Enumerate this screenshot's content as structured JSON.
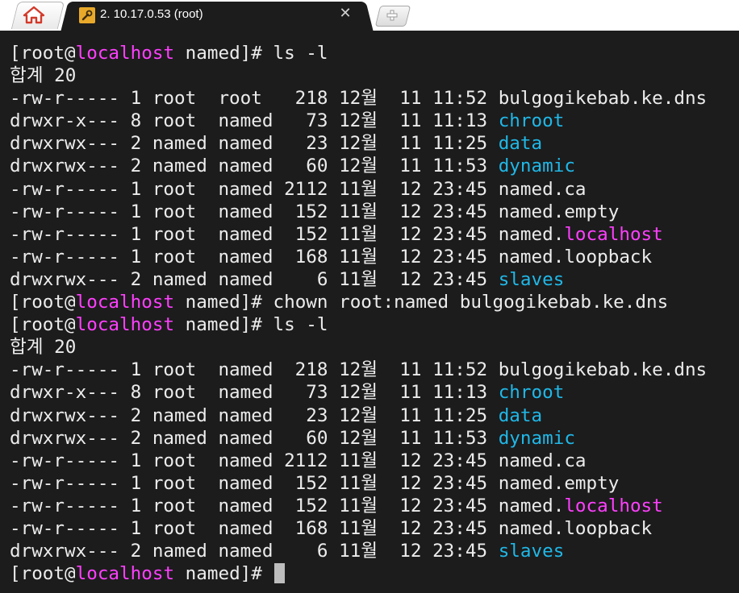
{
  "tabs": {
    "home_icon": "home-icon",
    "session_icon": "wrench-icon",
    "session_title": "2. 10.17.0.53 (root)",
    "close_icon": "close-icon",
    "close_glyph": "✕",
    "new_tab_icon": "plus-icon"
  },
  "colors": {
    "background": "#1c1c1c",
    "text": "#ececec",
    "hostname": "#ff3fff",
    "directory": "#20b8e8",
    "cursor": "#bdbdbd"
  },
  "terminal": {
    "lines": [
      {
        "segments": [
          {
            "text": "[root@",
            "color": "default"
          },
          {
            "text": "localhost",
            "color": "magenta"
          },
          {
            "text": " named]# ls -l",
            "color": "default"
          }
        ]
      },
      {
        "segments": [
          {
            "text": "합계 20",
            "color": "default"
          }
        ]
      },
      {
        "segments": [
          {
            "text": "-rw-r----- 1 root  root   218 12월  11 11:52 bulgogikebab.ke.dns",
            "color": "default"
          }
        ]
      },
      {
        "segments": [
          {
            "text": "drwxr-x--- 8 root  named   73 12월  11 11:13 ",
            "color": "default"
          },
          {
            "text": "chroot",
            "color": "cyan"
          }
        ]
      },
      {
        "segments": [
          {
            "text": "drwxrwx--- 2 named named   23 12월  11 11:25 ",
            "color": "default"
          },
          {
            "text": "data",
            "color": "cyan"
          }
        ]
      },
      {
        "segments": [
          {
            "text": "drwxrwx--- 2 named named   60 12월  11 11:53 ",
            "color": "default"
          },
          {
            "text": "dynamic",
            "color": "cyan"
          }
        ]
      },
      {
        "segments": [
          {
            "text": "-rw-r----- 1 root  named 2112 11월  12 23:45 named.ca",
            "color": "default"
          }
        ]
      },
      {
        "segments": [
          {
            "text": "-rw-r----- 1 root  named  152 11월  12 23:45 named.empty",
            "color": "default"
          }
        ]
      },
      {
        "segments": [
          {
            "text": "-rw-r----- 1 root  named  152 11월  12 23:45 named.",
            "color": "default"
          },
          {
            "text": "localhost",
            "color": "magenta"
          }
        ]
      },
      {
        "segments": [
          {
            "text": "-rw-r----- 1 root  named  168 11월  12 23:45 named.loopback",
            "color": "default"
          }
        ]
      },
      {
        "segments": [
          {
            "text": "drwxrwx--- 2 named named    6 11월  12 23:45 ",
            "color": "default"
          },
          {
            "text": "slaves",
            "color": "cyan"
          }
        ]
      },
      {
        "segments": [
          {
            "text": "[root@",
            "color": "default"
          },
          {
            "text": "localhost",
            "color": "magenta"
          },
          {
            "text": " named]# chown root:named bulgogikebab.ke.dns",
            "color": "default"
          }
        ]
      },
      {
        "segments": [
          {
            "text": "[root@",
            "color": "default"
          },
          {
            "text": "localhost",
            "color": "magenta"
          },
          {
            "text": " named]# ls -l",
            "color": "default"
          }
        ]
      },
      {
        "segments": [
          {
            "text": "합계 20",
            "color": "default"
          }
        ]
      },
      {
        "segments": [
          {
            "text": "-rw-r----- 1 root  named  218 12월  11 11:52 bulgogikebab.ke.dns",
            "color": "default"
          }
        ]
      },
      {
        "segments": [
          {
            "text": "drwxr-x--- 8 root  named   73 12월  11 11:13 ",
            "color": "default"
          },
          {
            "text": "chroot",
            "color": "cyan"
          }
        ]
      },
      {
        "segments": [
          {
            "text": "drwxrwx--- 2 named named   23 12월  11 11:25 ",
            "color": "default"
          },
          {
            "text": "data",
            "color": "cyan"
          }
        ]
      },
      {
        "segments": [
          {
            "text": "drwxrwx--- 2 named named   60 12월  11 11:53 ",
            "color": "default"
          },
          {
            "text": "dynamic",
            "color": "cyan"
          }
        ]
      },
      {
        "segments": [
          {
            "text": "-rw-r----- 1 root  named 2112 11월  12 23:45 named.ca",
            "color": "default"
          }
        ]
      },
      {
        "segments": [
          {
            "text": "-rw-r----- 1 root  named  152 11월  12 23:45 named.empty",
            "color": "default"
          }
        ]
      },
      {
        "segments": [
          {
            "text": "-rw-r----- 1 root  named  152 11월  12 23:45 named.",
            "color": "default"
          },
          {
            "text": "localhost",
            "color": "magenta"
          }
        ]
      },
      {
        "segments": [
          {
            "text": "-rw-r----- 1 root  named  168 11월  12 23:45 named.loopback",
            "color": "default"
          }
        ]
      },
      {
        "segments": [
          {
            "text": "drwxrwx--- 2 named named    6 11월  12 23:45 ",
            "color": "default"
          },
          {
            "text": "slaves",
            "color": "cyan"
          }
        ]
      },
      {
        "segments": [
          {
            "text": "[root@",
            "color": "default"
          },
          {
            "text": "localhost",
            "color": "magenta"
          },
          {
            "text": " named]# ",
            "color": "default"
          }
        ],
        "cursor": true
      }
    ]
  }
}
